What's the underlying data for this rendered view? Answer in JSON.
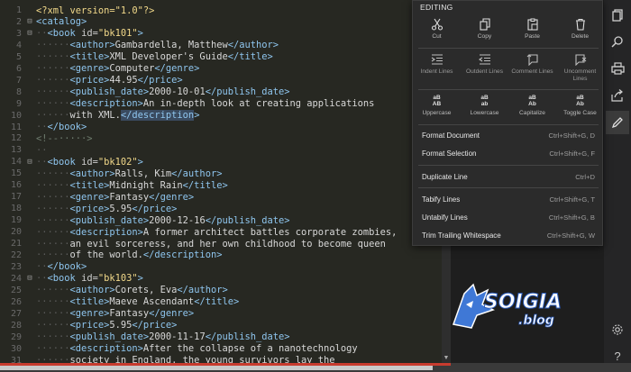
{
  "editor": {
    "lines": [
      {
        "n": "1",
        "fold": "",
        "html": "<span class='val'>&lt;?xml version=\"1.0\"?&gt;</span>"
      },
      {
        "n": "2",
        "fold": "⊟",
        "html": "<span class='tag'>&lt;catalog&gt;</span>"
      },
      {
        "n": "3",
        "fold": "⊟",
        "html": "<span class='dots'>··</span><span class='tag'>&lt;book</span> <span class='attr'>id=</span><span class='val'>\"bk101\"</span><span class='tag'>&gt;</span>"
      },
      {
        "n": "4",
        "fold": "",
        "html": "<span class='dots'>······</span><span class='tag'>&lt;author&gt;</span>Gambardella, Matthew<span class='tag'>&lt;/author&gt;</span>"
      },
      {
        "n": "5",
        "fold": "",
        "html": "<span class='dots'>······</span><span class='tag'>&lt;title&gt;</span>XML Developer's Guide<span class='tag'>&lt;/title&gt;</span>"
      },
      {
        "n": "6",
        "fold": "",
        "html": "<span class='dots'>······</span><span class='tag'>&lt;genre&gt;</span>Computer<span class='tag'>&lt;/genre&gt;</span>"
      },
      {
        "n": "7",
        "fold": "",
        "html": "<span class='dots'>······</span><span class='tag'>&lt;price&gt;</span>44.95<span class='tag'>&lt;/price&gt;</span>"
      },
      {
        "n": "8",
        "fold": "",
        "html": "<span class='dots'>······</span><span class='tag'>&lt;publish_date&gt;</span>2000-10-01<span class='tag'>&lt;/publish_date&gt;</span>"
      },
      {
        "n": "9",
        "fold": "",
        "html": "<span class='dots'>······</span><span class='tag'>&lt;description&gt;</span>An in-depth look at creating applications"
      },
      {
        "n": "10",
        "fold": "",
        "html": "<span class='dots'>······</span>with XML.<span class='sel'>&lt;/description</span><span class='tag'>&gt;</span>"
      },
      {
        "n": "11",
        "fold": "",
        "html": "<span class='dots'>··</span><span class='tag'>&lt;/book&gt;</span>"
      },
      {
        "n": "12",
        "fold": "",
        "html": "<span class='cmt'>&lt;!--·····&gt;</span>"
      },
      {
        "n": "13",
        "fold": "",
        "html": "<span class='dots'>··</span>"
      },
      {
        "n": "14",
        "fold": "⊟",
        "html": "<span class='dots'>··</span><span class='tag'>&lt;book</span> <span class='attr'>id=</span><span class='val'>\"bk102\"</span><span class='tag'>&gt;</span>"
      },
      {
        "n": "15",
        "fold": "",
        "html": "<span class='dots'>······</span><span class='tag'>&lt;author&gt;</span>Ralls, Kim<span class='tag'>&lt;/author&gt;</span>"
      },
      {
        "n": "16",
        "fold": "",
        "html": "<span class='dots'>······</span><span class='tag'>&lt;title&gt;</span>Midnight Rain<span class='tag'>&lt;/title&gt;</span>"
      },
      {
        "n": "17",
        "fold": "",
        "html": "<span class='dots'>······</span><span class='tag'>&lt;genre&gt;</span>Fantasy<span class='tag'>&lt;/genre&gt;</span>"
      },
      {
        "n": "18",
        "fold": "",
        "html": "<span class='dots'>······</span><span class='tag'>&lt;price&gt;</span>5.95<span class='tag'>&lt;/price&gt;</span>"
      },
      {
        "n": "19",
        "fold": "",
        "html": "<span class='dots'>······</span><span class='tag'>&lt;publish_date&gt;</span>2000-12-16<span class='tag'>&lt;/publish_date&gt;</span>"
      },
      {
        "n": "20",
        "fold": "",
        "html": "<span class='dots'>······</span><span class='tag'>&lt;description&gt;</span>A former architect battles corporate zombies,"
      },
      {
        "n": "21",
        "fold": "",
        "html": "<span class='dots'>······</span>an evil sorceress, and her own childhood to become queen"
      },
      {
        "n": "22",
        "fold": "",
        "html": "<span class='dots'>······</span>of the world.<span class='tag'>&lt;/description&gt;</span>"
      },
      {
        "n": "23",
        "fold": "",
        "html": "<span class='dots'>··</span><span class='tag'>&lt;/book&gt;</span>"
      },
      {
        "n": "24",
        "fold": "⊟",
        "html": "<span class='dots'>··</span><span class='tag'>&lt;book</span> <span class='attr'>id=</span><span class='val'>\"bk103\"</span><span class='tag'>&gt;</span>"
      },
      {
        "n": "25",
        "fold": "",
        "html": "<span class='dots'>······</span><span class='tag'>&lt;author&gt;</span>Corets, Eva<span class='tag'>&lt;/author&gt;</span>"
      },
      {
        "n": "26",
        "fold": "",
        "html": "<span class='dots'>······</span><span class='tag'>&lt;title&gt;</span>Maeve Ascendant<span class='tag'>&lt;/title&gt;</span>"
      },
      {
        "n": "27",
        "fold": "",
        "html": "<span class='dots'>······</span><span class='tag'>&lt;genre&gt;</span>Fantasy<span class='tag'>&lt;/genre&gt;</span>"
      },
      {
        "n": "28",
        "fold": "",
        "html": "<span class='dots'>······</span><span class='tag'>&lt;price&gt;</span>5.95<span class='tag'>&lt;/price&gt;</span>"
      },
      {
        "n": "29",
        "fold": "",
        "html": "<span class='dots'>······</span><span class='tag'>&lt;publish_date&gt;</span>2000-11-17<span class='tag'>&lt;/publish_date&gt;</span>"
      },
      {
        "n": "30",
        "fold": "",
        "html": "<span class='dots'>······</span><span class='tag'>&lt;description&gt;</span>After the collapse of a nanotechnology"
      },
      {
        "n": "31",
        "fold": "",
        "html": "<span class='dots'>······</span>society in England, the young survivors lay the"
      }
    ]
  },
  "menu": {
    "title": "EDITING",
    "row1": [
      {
        "label": "Cut",
        "icon": "scissors-icon"
      },
      {
        "label": "Copy",
        "icon": "copy-icon"
      },
      {
        "label": "Paste",
        "icon": "paste-icon"
      },
      {
        "label": "Delete",
        "icon": "trash-icon"
      }
    ],
    "row2": [
      {
        "label": "Indent Lines",
        "icon": "indent-icon"
      },
      {
        "label": "Outdent Lines",
        "icon": "outdent-icon"
      },
      {
        "label": "Comment Lines",
        "icon": "comment-icon"
      },
      {
        "label": "Uncomment Lines",
        "icon": "uncomment-icon"
      }
    ],
    "row3": [
      {
        "label": "Uppercase",
        "icon": "uppercase-icon",
        "glyph_top": "aB",
        "glyph_bot": "AB"
      },
      {
        "label": "Lowercase",
        "icon": "lowercase-icon",
        "glyph_top": "aB",
        "glyph_bot": "ab"
      },
      {
        "label": "Capitalize",
        "icon": "capitalize-icon",
        "glyph_top": "aB",
        "glyph_bot": "Ab"
      },
      {
        "label": "Toggle Case",
        "icon": "toggle-case-icon",
        "glyph_top": "aB",
        "glyph_bot": "Ab"
      }
    ],
    "items": [
      {
        "label": "Format Document",
        "shortcut": "Ctrl+Shift+G, D"
      },
      {
        "label": "Format Selection",
        "shortcut": "Ctrl+Shift+G, F"
      },
      {
        "label": "Duplicate Line",
        "shortcut": "Ctrl+D"
      },
      {
        "label": "Tabify Lines",
        "shortcut": "Ctrl+Shift+G, T"
      },
      {
        "label": "Untabify Lines",
        "shortcut": "Ctrl+Shift+G, B"
      },
      {
        "label": "Trim Trailing Whitespace",
        "shortcut": "Ctrl+Shift+G, W"
      }
    ]
  },
  "sidebar": {
    "icons": [
      "copy-file-icon",
      "search-icon",
      "print-icon",
      "share-icon",
      "edit-pen-icon",
      "settings-gear-icon",
      "help-icon"
    ]
  },
  "logo": {
    "text_main": "SOIGIA",
    "text_sub": ".blog"
  },
  "colors": {
    "accent_bar": "#c83b2e",
    "editor_bg": "#272822",
    "menu_bg": "#2b2b2b"
  }
}
